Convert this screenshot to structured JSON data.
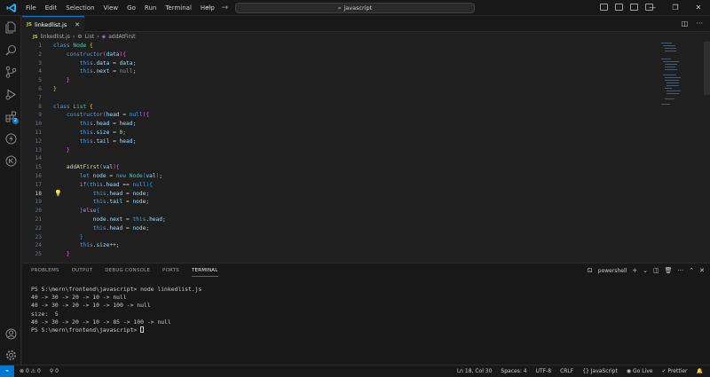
{
  "menu": [
    "File",
    "Edit",
    "Selection",
    "View",
    "Go",
    "Run",
    "Terminal",
    "Help"
  ],
  "search": {
    "text": "javascript"
  },
  "tab": {
    "name": "linkedlist.js",
    "lang_badge": "JS"
  },
  "breadcrumb": {
    "file": "linkedlist.js",
    "class": "List",
    "method": "addAtFirst"
  },
  "editor": {
    "line_numbers": [
      "1",
      "2",
      "3",
      "4",
      "5",
      "6",
      "7",
      "8",
      "9",
      "10",
      "11",
      "12",
      "13",
      "14",
      "15",
      "16",
      "17",
      "18",
      "19",
      "20",
      "21",
      "22",
      "23",
      "24",
      "25"
    ],
    "active_line": "18"
  },
  "panel": {
    "tabs": [
      "PROBLEMS",
      "OUTPUT",
      "DEBUG CONSOLE",
      "PORTS",
      "TERMINAL"
    ],
    "active_tab": "TERMINAL",
    "shell": "powershell"
  },
  "terminal": {
    "lines": [
      "PS S:\\mern\\frontend\\javascript> node linkedlist.js",
      "40 -> 30 -> 20 -> 10 -> null",
      "40 -> 30 -> 20 -> 10 -> 100 -> null",
      "size:  5",
      "40 -> 30 -> 20 -> 10 -> 85 -> 100 -> null"
    ],
    "prompt": "PS S:\\mern\\frontend\\javascript> "
  },
  "status": {
    "errors": "0",
    "warnings": "0",
    "ports": "0",
    "position": "Ln 18, Col 30",
    "spaces": "Spaces: 4",
    "encoding": "UTF-8",
    "eol": "CRLF",
    "language": "{} JavaScript",
    "golive": "Go Live",
    "prettier": "✓ Prettier"
  },
  "colors": {
    "accent": "#0078d4",
    "background": "#1f1f1f",
    "chrome": "#181818"
  }
}
